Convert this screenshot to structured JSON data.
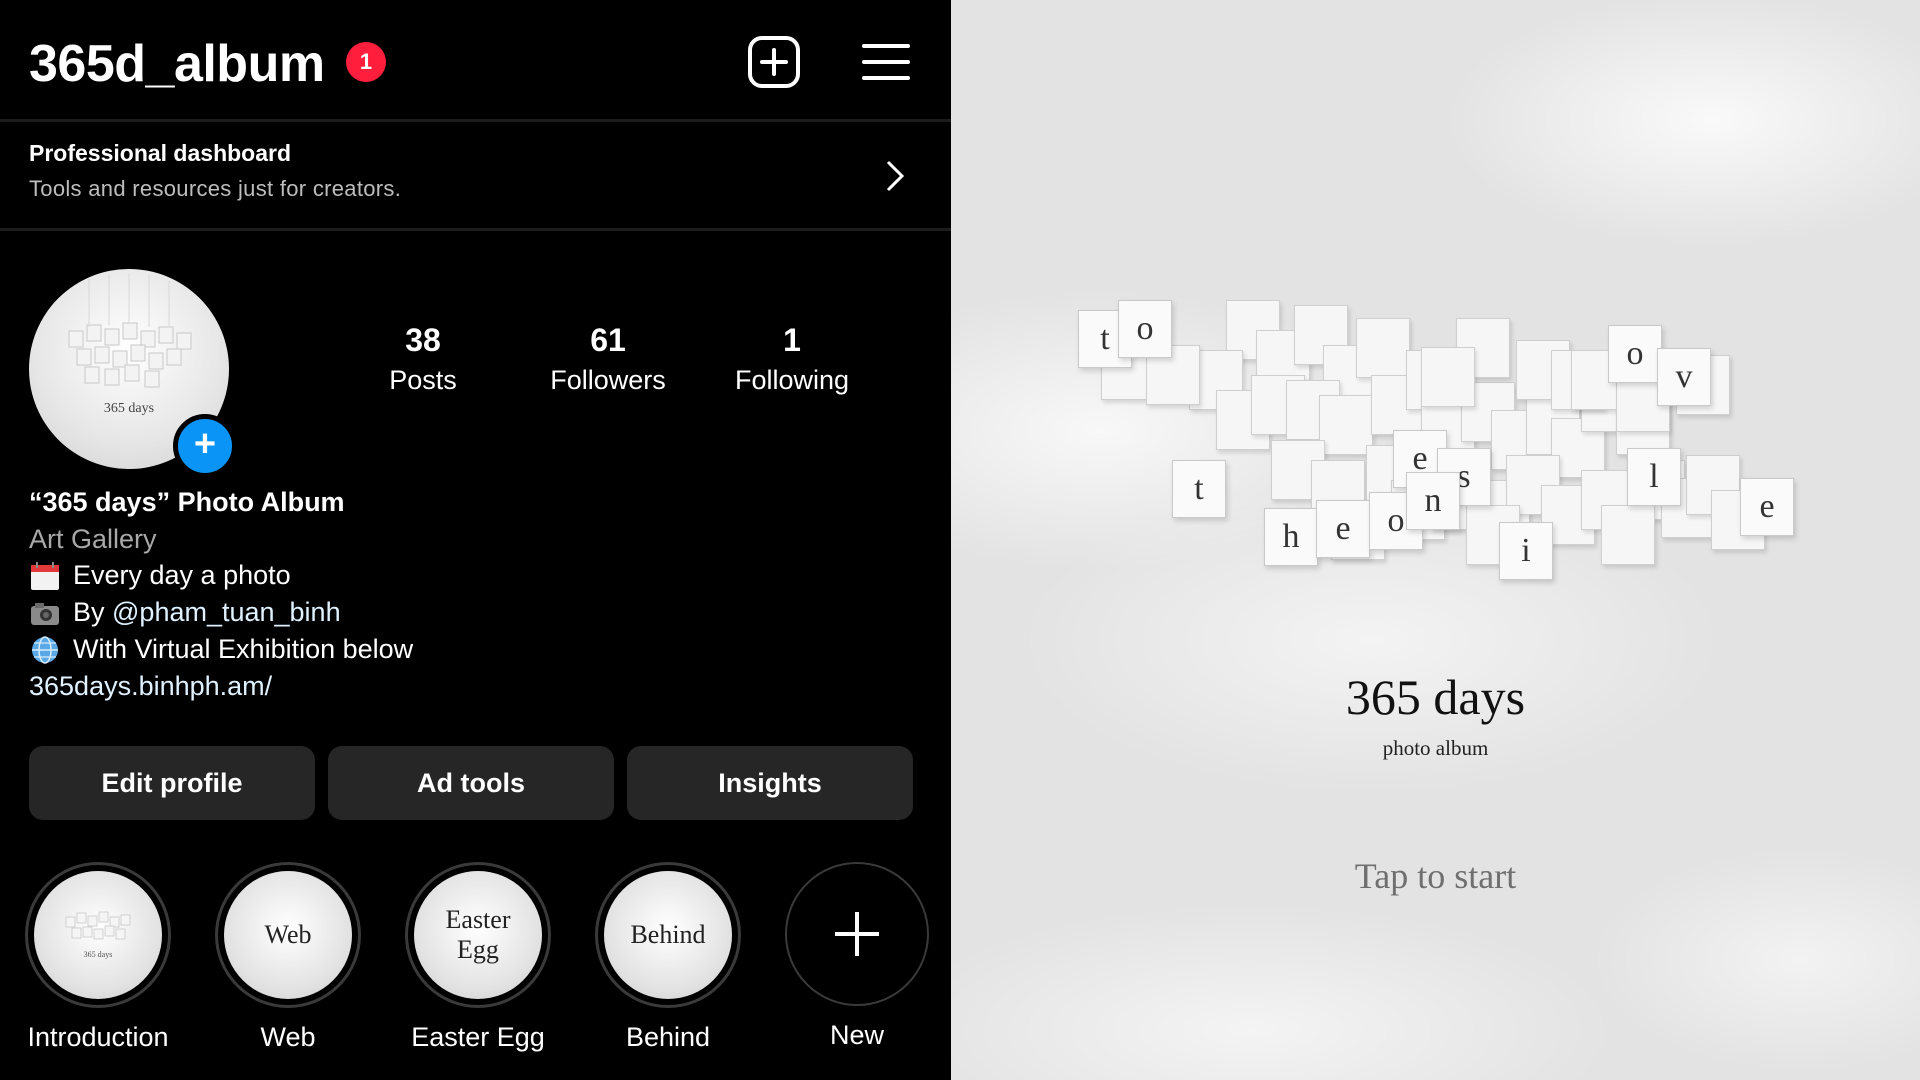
{
  "header": {
    "username": "365d_album",
    "notification_count": "1"
  },
  "dashboard": {
    "title": "Professional dashboard",
    "subtitle": "Tools and resources just for creators."
  },
  "profile": {
    "avatar_text": "365 days",
    "stats": [
      {
        "value": "38",
        "label": "Posts"
      },
      {
        "value": "61",
        "label": "Followers"
      },
      {
        "value": "1",
        "label": "Following"
      }
    ],
    "name": "“365 days” Photo Album",
    "category": "Art Gallery",
    "bio_lines": [
      "Every day a photo",
      "By ",
      "With Virtual Exhibition below"
    ],
    "mention": "@pham_tuan_binh",
    "link": "365days.binhph.am/"
  },
  "buttons": {
    "edit": "Edit profile",
    "ad_tools": "Ad tools",
    "insights": "Insights"
  },
  "highlights": [
    {
      "label": "Introduction",
      "cover": ""
    },
    {
      "label": "Web",
      "cover": "Web"
    },
    {
      "label": "Easter Egg",
      "cover_line1": "Easter",
      "cover_line2": "Egg"
    },
    {
      "label": "Behind",
      "cover": "Behind"
    },
    {
      "label": "New"
    }
  ],
  "album": {
    "title": "365 days",
    "subtitle": "photo album",
    "cta": "Tap to start",
    "letters": [
      "t",
      "o",
      "o",
      "v",
      "t",
      "e",
      "s",
      "l",
      "e",
      "h",
      "e",
      "o",
      "n",
      "i"
    ]
  },
  "colors": {
    "badge": "#ff1f3d",
    "accent_blue": "#0a95f6",
    "button_bg": "#262626"
  }
}
